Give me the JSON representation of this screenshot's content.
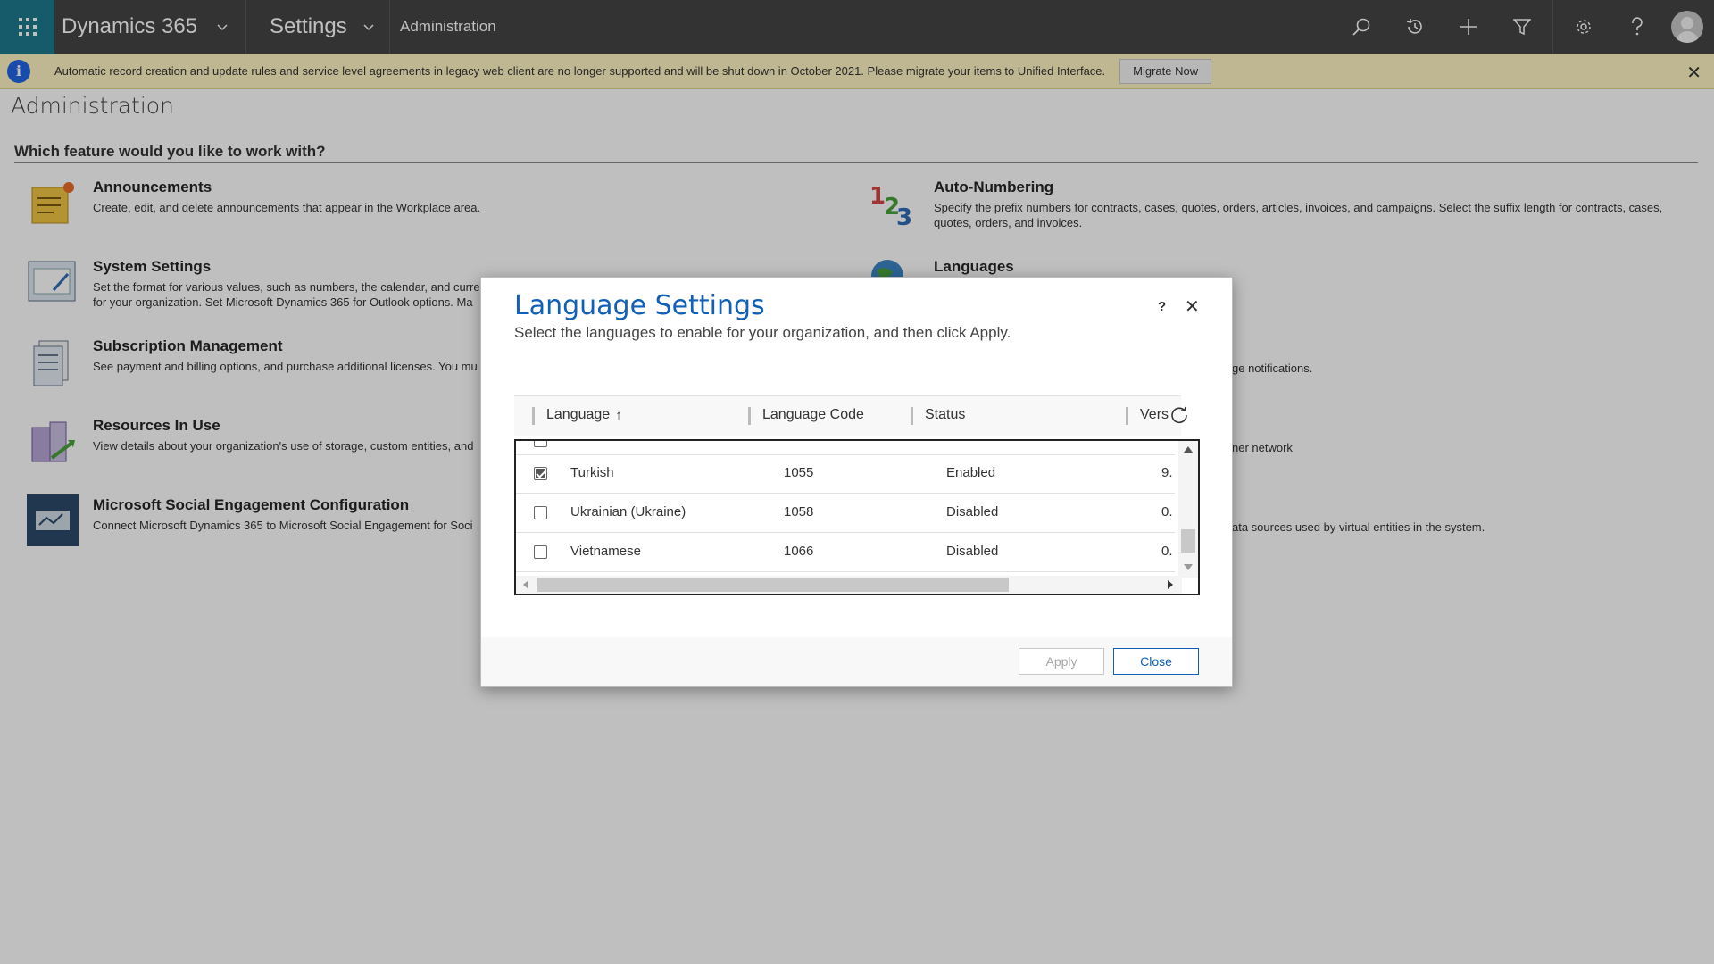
{
  "nav": {
    "app_title": "Dynamics 365",
    "area_title": "Settings",
    "breadcrumb": "Administration",
    "icons": [
      "waffle-icon",
      "search-icon",
      "recent-icon",
      "new-icon",
      "filter-icon",
      "gear-icon",
      "help-icon",
      "avatar"
    ]
  },
  "notification": {
    "message": "Automatic record creation and update rules and service level agreements in legacy web client are no longer supported and will be shut down in October 2021. Please migrate your items to Unified Interface.",
    "button_label": "Migrate Now",
    "close_glyph": "✕"
  },
  "page": {
    "title": "Administration",
    "question": "Which feature would you like to work with?",
    "features_left": [
      {
        "title": "Announcements",
        "desc": "Create, edit, and delete announcements that appear in the Workplace area."
      },
      {
        "title": "System Settings",
        "desc": "Set the format for various values, such as numbers, the calendar, and curre",
        "desc2": "for your organization. Set Microsoft Dynamics 365 for Outlook options. Ma"
      },
      {
        "title": "Subscription Management",
        "desc": "See payment and billing options, and purchase additional licenses. You mu"
      },
      {
        "title": "Resources In Use",
        "desc": "View details about your organization's use of storage, custom entities, and"
      },
      {
        "title": "Microsoft Social Engagement Configuration",
        "desc": "Connect Microsoft Dynamics 365 to Microsoft Social Engagement for Soci"
      }
    ],
    "features_right": [
      {
        "title": "Auto-Numbering",
        "desc": "Specify the prefix numbers for contracts, cases, quotes, orders, articles, invoices, and campaigns. Select the suffix length for contracts, cases,",
        "desc2": "quotes, orders, and invoices."
      },
      {
        "title": "Languages",
        "desc": ""
      },
      {
        "title": "",
        "desc": "ge notifications."
      },
      {
        "title": "",
        "desc": "ner network"
      },
      {
        "title": "",
        "desc": "ata sources used by virtual entities in the system."
      }
    ]
  },
  "dialog": {
    "title": "Language Settings",
    "subtitle": "Select the languages to enable for your organization, and then click Apply.",
    "help": "?",
    "close_glyph": "✕",
    "columns": [
      "Language",
      "Language Code",
      "Status",
      "Vers"
    ],
    "sort_arrow": "↑",
    "rows": [
      {
        "checked": true,
        "language": "Turkish",
        "code": "1055",
        "status": "Enabled",
        "version": "9."
      },
      {
        "checked": false,
        "language": "Ukrainian (Ukraine)",
        "code": "1058",
        "status": "Disabled",
        "version": "0."
      },
      {
        "checked": false,
        "language": "Vietnamese",
        "code": "1066",
        "status": "Disabled",
        "version": "0."
      }
    ],
    "apply_label": "Apply",
    "close_label": "Close"
  }
}
